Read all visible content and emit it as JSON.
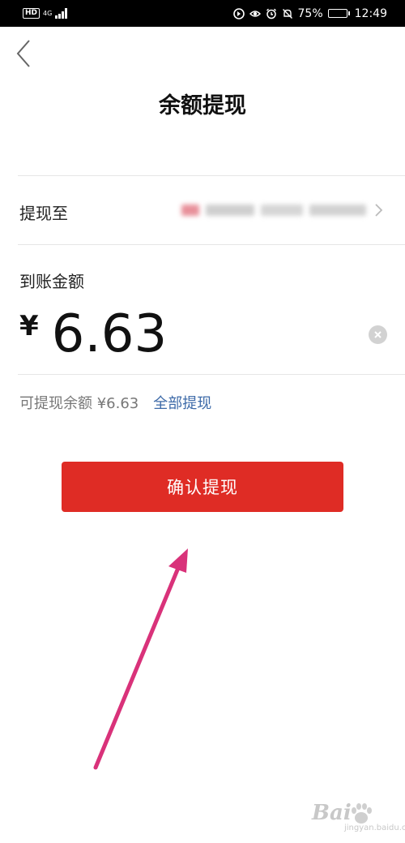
{
  "status_bar": {
    "hd": "HD",
    "network": "4G",
    "battery_percent": "75%",
    "battery_level": 0.75,
    "time": "12:49"
  },
  "header": {
    "title": "余额提现"
  },
  "withdraw_to": {
    "label": "提现至"
  },
  "amount": {
    "label": "到账金额",
    "currency": "¥",
    "value": "6.63"
  },
  "balance": {
    "available_text": "可提现余额 ¥6.63",
    "withdraw_all": "全部提现"
  },
  "confirm_button": {
    "label": "确认提现"
  },
  "watermark": {
    "text": "Bai",
    "sub": "jingyan.baidu.com"
  },
  "colors": {
    "accent_red": "#df2c25",
    "link_blue": "#3d6aa8",
    "annotation_arrow": "#d9327a"
  }
}
